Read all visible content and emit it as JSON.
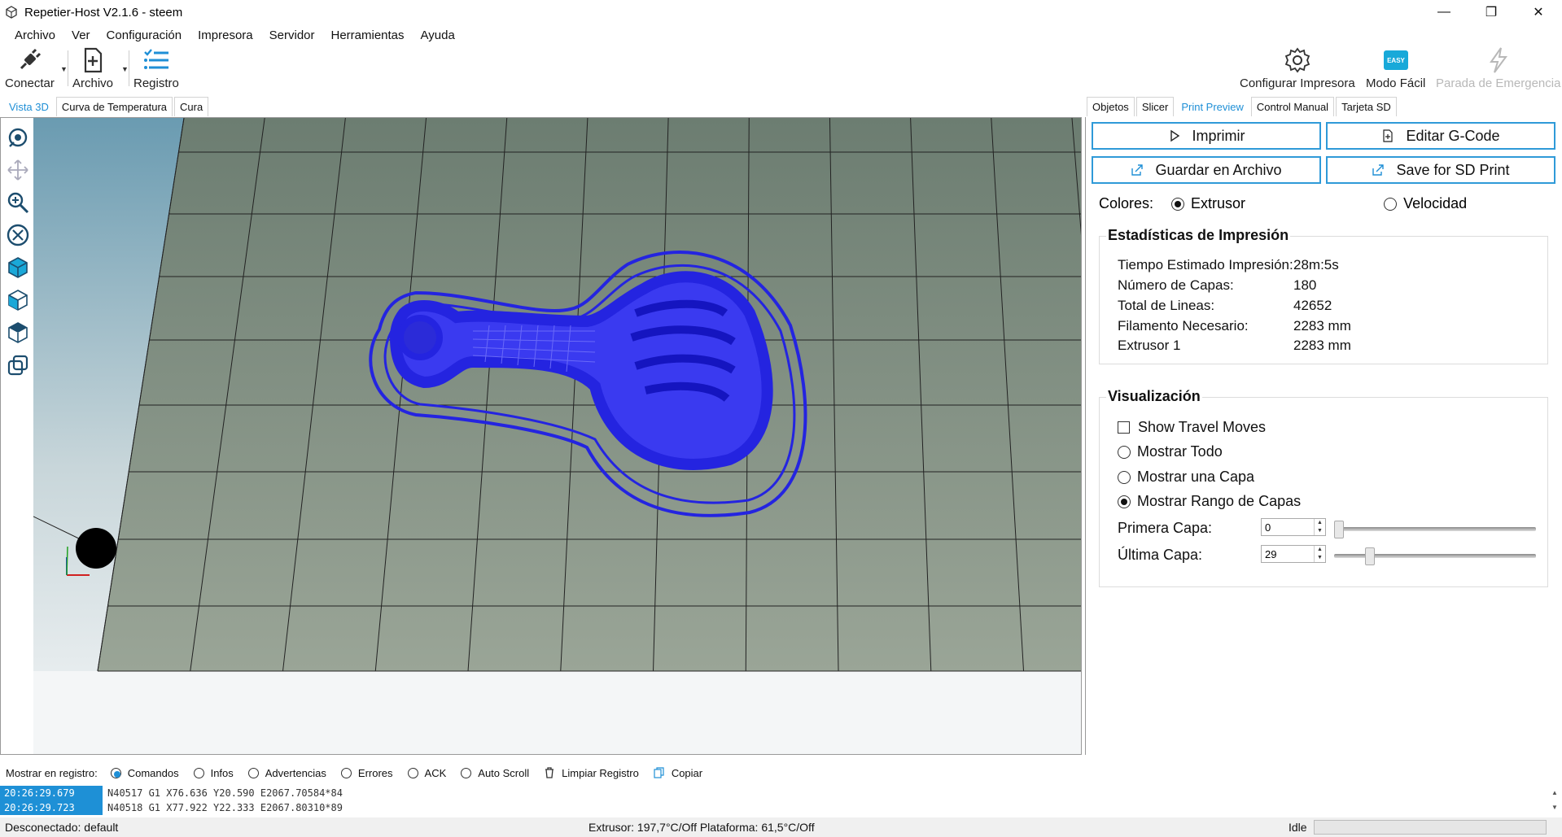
{
  "window": {
    "title": "Repetier-Host V2.1.6 - steem"
  },
  "menu": [
    "Archivo",
    "Ver",
    "Configuración",
    "Impresora",
    "Servidor",
    "Herramientas",
    "Ayuda"
  ],
  "toolbar": {
    "connect": "Conectar",
    "file": "Archivo",
    "log": "Registro",
    "configure_printer": "Configurar Impresora",
    "easy_mode": "Modo Fácil",
    "easy_badge": "EASY",
    "emergency_stop": "Parada de Emergencia"
  },
  "left_tabs": [
    "Vista 3D",
    "Curva de Temperatura",
    "Cura"
  ],
  "right_tabs": [
    "Objetos",
    "Slicer",
    "Print Preview",
    "Control Manual",
    "Tarjeta SD"
  ],
  "preview": {
    "print_button": "Imprimir",
    "edit_gcode_button": "Editar G-Code",
    "save_file_button": "Guardar en Archivo",
    "save_sd_button": "Save for SD Print",
    "colors_label": "Colores:",
    "color_extruder": "Extrusor",
    "color_speed": "Velocidad",
    "stats": {
      "title": "Estadísticas de Impresión",
      "rows": [
        {
          "label": "Tiempo Estimado Impresión:",
          "value": "28m:5s"
        },
        {
          "label": "Número de Capas:",
          "value": "180"
        },
        {
          "label": "Total de Lineas:",
          "value": "42652"
        },
        {
          "label": "Filamento Necesario:",
          "value": "2283 mm"
        },
        {
          "label": "Extrusor 1",
          "value": "2283 mm"
        }
      ]
    },
    "visualization": {
      "title": "Visualización",
      "show_travel": "Show Travel Moves",
      "show_all": "Mostrar Todo",
      "show_one_layer": "Mostrar una Capa",
      "show_range": "Mostrar Rango de Capas",
      "first_layer_label": "Primera Capa:",
      "first_layer_value": "0",
      "last_layer_label": "Última Capa:",
      "last_layer_value": "29"
    }
  },
  "log": {
    "show_label": "Mostrar en registro:",
    "commands": "Comandos",
    "infos": "Infos",
    "warnings": "Advertencias",
    "errors": "Errores",
    "ack": "ACK",
    "autoscroll": "Auto Scroll",
    "clear": "Limpiar Registro",
    "copy": "Copiar",
    "lines": [
      {
        "time": "20:26:29.679",
        "cmd": "N40517 G1 X76.636 Y20.590 E2067.70584*84"
      },
      {
        "time": "20:26:29.723",
        "cmd": "N40518 G1 X77.922 Y22.333 E2067.80310*89"
      }
    ]
  },
  "status": {
    "connection": "Desconectado: default",
    "temperatures": "Extrusor: 197,7°C/Off Plataforma: 61,5°C/Off",
    "state": "Idle"
  },
  "colors": {
    "accent": "#1f8fd6",
    "model": "#2222dd",
    "bed": "#7f8d80"
  }
}
